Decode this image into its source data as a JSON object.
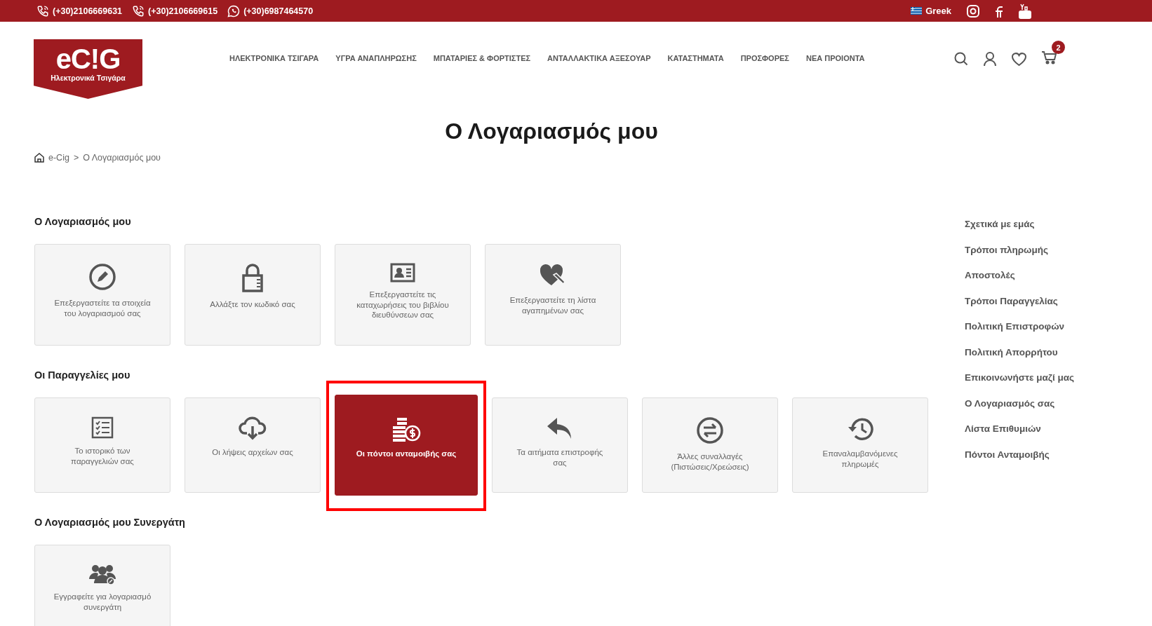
{
  "top_bar": {
    "phones": [
      "(+30)2106669631",
      "(+30)2106669615",
      "(+30)6987464570"
    ],
    "language": "Greek"
  },
  "header": {
    "logo": {
      "wordmark": "eC!G",
      "tagline": "Ηλεκτρονικά Τσιγάρα"
    },
    "nav": [
      "ΗΛΕΚΤΡΟΝΙΚΑ ΤΣΙΓΑΡΑ",
      "ΥΓΡΑ ΑΝΑΠΛΗΡΩΣΗΣ",
      "ΜΠΑΤΑΡΙΕΣ & ΦΟΡΤΙΣΤΕΣ",
      "ΑΝΤΑΛΛΑΚΤΙΚΑ ΑΞΕΣΟΥΑΡ",
      "ΚΑΤΑΣΤΗΜΑΤΑ",
      "ΠΡΟΣΦΟΡΕΣ",
      "ΝΕΑ ΠΡΟΙΟΝΤΑ"
    ],
    "cart_count": "2"
  },
  "title": "Ο Λογαριασμός μου",
  "breadcrumb": {
    "items": [
      "e-Cig",
      "Ο Λογαριασμός μου"
    ],
    "separator": ">"
  },
  "sections": [
    {
      "title": "Ο Λογαριασμός μου",
      "cards": [
        {
          "label": "Επεξεργαστείτε τα στοιχεία του λογαριασμού σας",
          "selected": false
        },
        {
          "label": "Αλλάξτε τον κωδικό σας",
          "selected": false
        },
        {
          "label": "Επεξεργαστείτε τις καταχωρήσεις του βιβλίου διευθύνσεων σας",
          "selected": false
        },
        {
          "label": "Επεξεργαστείτε τη λίστα αγαπημένων σας",
          "selected": false
        }
      ]
    },
    {
      "title": "Οι Παραγγελίες μου",
      "cards": [
        {
          "label": "Το ιστορικό των παραγγελιών σας",
          "selected": false
        },
        {
          "label": "Οι λήψεις αρχείων σας",
          "selected": false
        },
        {
          "label": "Οι πόντοι ανταμοιβής σας",
          "selected": true
        },
        {
          "label": "Τα αιτήματα επιστροφής σας",
          "selected": false
        },
        {
          "label": "Άλλες συναλλαγές (Πιστώσεις/Χρεώσεις)",
          "selected": false
        },
        {
          "label": "Επαναλαμβανόμενες πληρωμές",
          "selected": false
        }
      ]
    },
    {
      "title": "Ο Λογαριασμός μου Συνεργάτη",
      "cards": [
        {
          "label": "Εγγραφείτε για λογαριασμό συνεργάτη",
          "selected": false
        }
      ]
    }
  ],
  "sidebar": {
    "items": [
      "Σχετικά με εμάς",
      "Τρόποι πληρωμής",
      "Αποστολές",
      "Τρόποι Παραγγελίας",
      "Πολιτική Επιστροφών",
      "Πολιτική Απορρήτου",
      "Επικοινωνήστε μαζί μας",
      "Ο Λογαριασμός σας",
      "Λίστα Επιθυμιών",
      "Πόντοι Ανταμοιβής"
    ]
  }
}
